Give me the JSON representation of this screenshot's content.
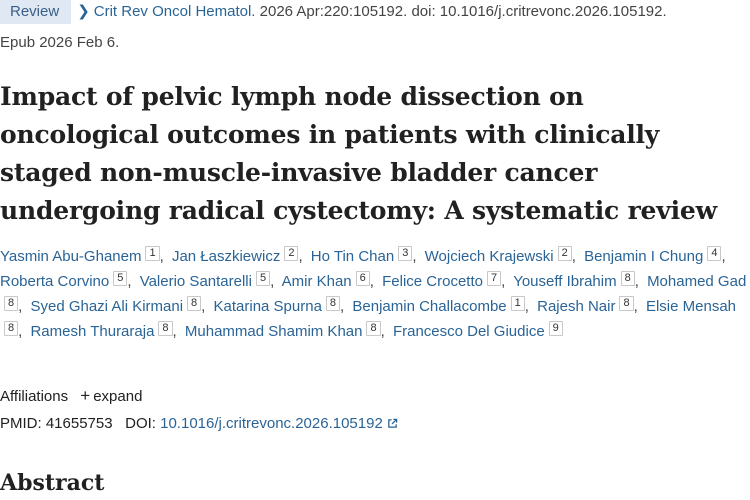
{
  "publication": {
    "badge": "Review",
    "journal": "Crit Rev Oncol Hematol.",
    "citation": " 2026 Apr:220:105192. doi: 10.1016/j.critrevonc.2026.105192.",
    "epub": "Epub 2026 Feb 6."
  },
  "article": {
    "title": "Impact of pelvic lymph node dissection on oncological outcomes in patients with clinically staged non-muscle-invasive bladder cancer undergoing radical cystectomy: A systematic review"
  },
  "authors": [
    {
      "name": "Yasmin Abu-Ghanem",
      "aff": "1"
    },
    {
      "name": "Jan Łaszkiewicz",
      "aff": "2"
    },
    {
      "name": "Ho Tin Chan",
      "aff": "3"
    },
    {
      "name": "Wojciech Krajewski",
      "aff": "2"
    },
    {
      "name": "Benjamin I Chung",
      "aff": "4"
    },
    {
      "name": "Roberta Corvino",
      "aff": "5"
    },
    {
      "name": "Valerio Santarelli",
      "aff": "5"
    },
    {
      "name": "Amir Khan",
      "aff": "6"
    },
    {
      "name": "Felice Crocetto",
      "aff": "7"
    },
    {
      "name": "Youseff Ibrahim",
      "aff": "8"
    },
    {
      "name": "Mohamed Gad",
      "aff": "8"
    },
    {
      "name": "Syed Ghazi Ali Kirmani",
      "aff": "8"
    },
    {
      "name": "Katarina Spurna",
      "aff": "8"
    },
    {
      "name": "Benjamin Challacombe",
      "aff": "1"
    },
    {
      "name": "Rajesh Nair",
      "aff": "8"
    },
    {
      "name": "Elsie Mensah",
      "aff": "8"
    },
    {
      "name": "Ramesh Thuraraja",
      "aff": "8"
    },
    {
      "name": "Muhammad Shamim Khan",
      "aff": "8"
    },
    {
      "name": "Francesco Del Giudice",
      "aff": "9"
    }
  ],
  "affiliations": {
    "label": "Affiliations",
    "toggle_icon": "+",
    "toggle_label": "expand"
  },
  "identifiers": {
    "pmid_label": "PMID:",
    "pmid": "41655753",
    "doi_label": "DOI:",
    "doi": "10.1016/j.critrevonc.2026.105192",
    "doi_icon": "external-link-icon"
  },
  "abstract": {
    "heading": "Abstract"
  },
  "colors": {
    "link": "#2a6496",
    "badge_bg": "#dfe8f3",
    "badge_text": "#3a5f87",
    "text": "#212121"
  }
}
